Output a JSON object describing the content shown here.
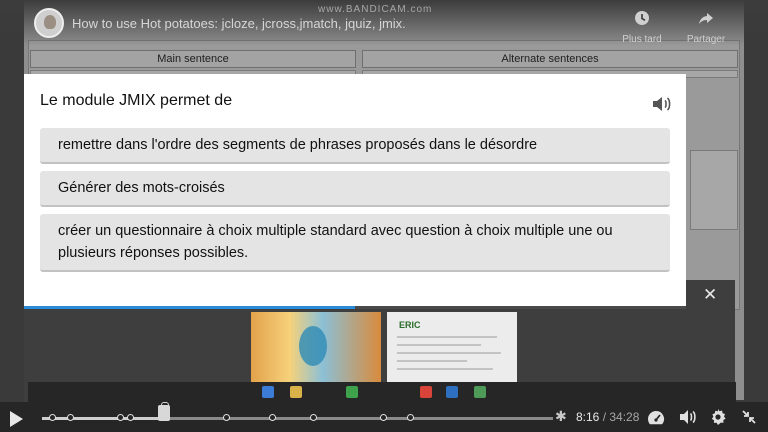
{
  "video": {
    "watermark": "www.BANDICAM.com",
    "title": "How to use Hot potatoes: jcloze, jcross,jmatch, jquiz, jmix.",
    "actions": [
      {
        "icon": "clock-icon",
        "label": "Plus tard"
      },
      {
        "icon": "share-icon",
        "label": "Partager"
      }
    ],
    "column_headers": {
      "left": "Main sentence",
      "right": "Alternate sentences"
    }
  },
  "quiz": {
    "question": "Le module JMIX permet de",
    "answers": [
      "remettre dans l'ordre des segments de phrases proposés dans le désordre",
      "Générer des mots-croisés",
      "créer un questionnaire à choix multiple standard avec question à choix multiple une ou plusieurs réponses possibles."
    ],
    "progress": 0.5,
    "colors": {
      "accent": "#2a8bd8",
      "card": "#ffffff",
      "answer_bg": "#e4e4e4"
    }
  },
  "player": {
    "current_time": "8:16",
    "separator": " / ",
    "total_time": "34:28",
    "played_fraction": 0.24,
    "chapter_markers": [
      0.02,
      0.055,
      0.152,
      0.173,
      0.361,
      0.451,
      0.531,
      0.668,
      0.721
    ]
  }
}
